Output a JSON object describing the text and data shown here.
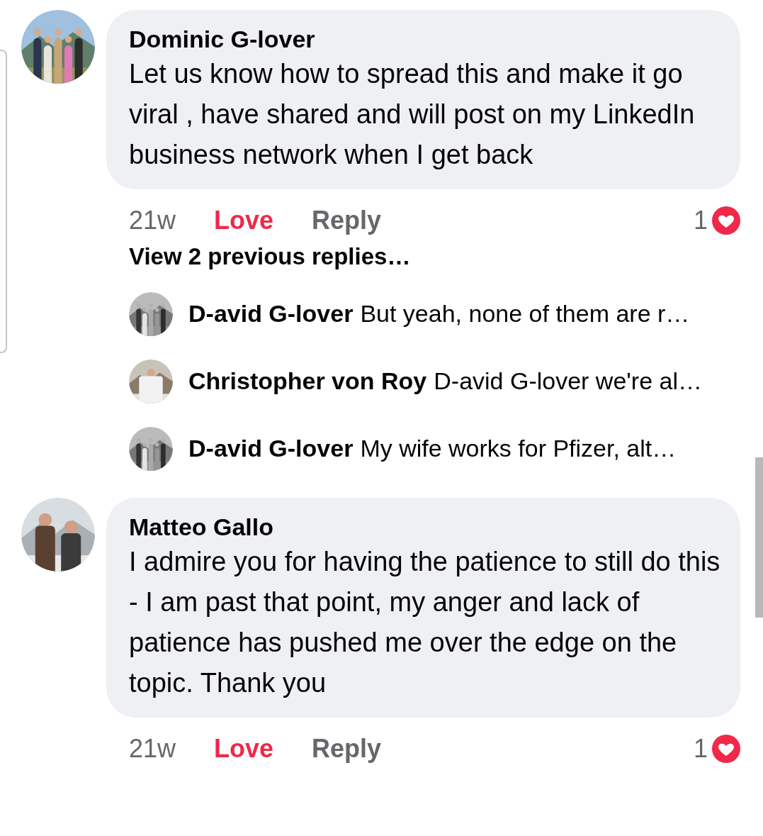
{
  "comments": [
    {
      "author": "Dominic G-lover",
      "text": "Let us know how to spread this and make it go viral , have shared and will post on my LinkedIn business network when I get back",
      "time": "21w",
      "love_label": "Love",
      "loved": true,
      "reply_label": "Reply",
      "reaction_count": "1",
      "view_previous": "View 2 previous replies…",
      "replies": [
        {
          "author": "D-avid G-lover",
          "text": "But yeah, none of them are r…",
          "avatar_mono": true
        },
        {
          "author": "Christopher von Roy",
          "text": "D-avid G-lover we're al…",
          "avatar_mono": false
        },
        {
          "author": "D-avid G-lover",
          "text": "My wife works for Pfizer, alt…",
          "avatar_mono": true
        }
      ]
    },
    {
      "author": "Matteo Gallo",
      "text": "I admire you for having the patience to still do this - I am past that point, my anger and lack of patience has pushed me over the edge on the topic. Thank you",
      "time": "21w",
      "love_label": "Love",
      "loved": true,
      "reply_label": "Reply",
      "reaction_count": "1"
    }
  ]
}
